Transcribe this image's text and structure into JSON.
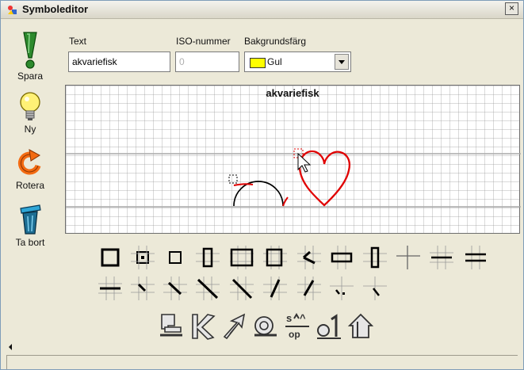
{
  "window": {
    "title": "Symboleditor",
    "close_label": "×"
  },
  "toolbar": {
    "save_label": "Spara",
    "new_label": "Ny",
    "rotate_label": "Rotera",
    "delete_label": "Ta bort"
  },
  "form": {
    "text_label": "Text",
    "text_value": "akvariefisk",
    "iso_label": "ISO-nummer",
    "iso_value": "0",
    "bg_label": "Bakgrundsfärg",
    "bg_value": "Gul",
    "bg_color": "#ffff00"
  },
  "canvas": {
    "title": "akvariefisk",
    "stroke_black": "#000000",
    "stroke_red": "#e00000"
  },
  "palette": {
    "row1": [
      "square-heavy-icon",
      "square-center-dot-icon",
      "square-small-icon",
      "vertical-bar-icon",
      "wide-square-icon",
      "square-right-bar-icon",
      "chevron-left-diagonal-icon",
      "horizontal-bar-thick-icon",
      "vertical-bar-tall-icon",
      "cross-thin-icon",
      "double-horizontal-icon",
      "horizontal-lines-icon"
    ],
    "row2": [
      "horizontal-line-icon",
      "short-diagonal-icon",
      "medium-diagonal-icon",
      "long-diagonal-icon",
      "long-diagonal-alt-icon",
      "diagonal-up-icon",
      "corner-diagonal-icon",
      "small-corner-icon",
      "corner-dot-icon"
    ]
  },
  "commands": {
    "op_label": "op",
    "items": [
      "stamp-icon",
      "arrow-in-icon",
      "arrow-out-icon",
      "rotate-icon",
      "swap-icon",
      "numeric-icon",
      "home-icon"
    ]
  }
}
